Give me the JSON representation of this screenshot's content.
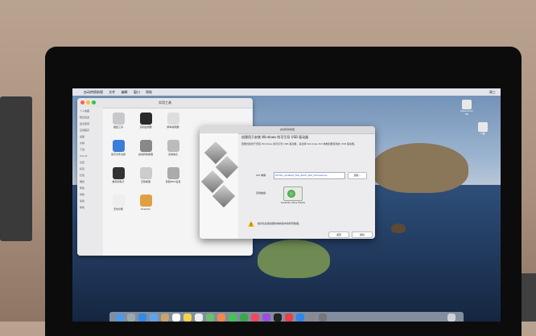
{
  "menubar": {
    "app": "启动转换助理",
    "items": [
      "文件",
      "编辑",
      "窗口",
      "帮助"
    ],
    "right": "周三"
  },
  "finder": {
    "title": "实用工具",
    "sidebar": [
      "个人收藏",
      "隔空投送",
      "最近使用",
      "应用程序",
      "桌面",
      "文稿",
      "下载",
      "iCloud",
      "位置",
      "标签",
      "红色",
      "橙色",
      "黄色",
      "绿色",
      "蓝色",
      "紫色"
    ],
    "apps": [
      {
        "label": "磁盘工具",
        "color": "#c8c8cc"
      },
      {
        "label": "活动监视器",
        "color": "#2a2a2a"
      },
      {
        "label": "脚本编辑器",
        "color": "#ddd"
      },
      {
        "label": "蓝牙文件交换",
        "color": "#3b7dd8"
      },
      {
        "label": "启动转换助理",
        "color": "#888"
      },
      {
        "label": "系统信息",
        "color": "#bbb"
      },
      {
        "label": "数码测色计",
        "color": "#333"
      },
      {
        "label": "迁移助理",
        "color": "#ccc"
      },
      {
        "label": "音频MIDI设置",
        "color": "#aaa"
      },
      {
        "label": "无线诊断",
        "color": "#eee"
      },
      {
        "label": "Grapher",
        "color": "#e0a040"
      }
    ]
  },
  "dialog": {
    "bar_title": "启动转换助理",
    "title": "创建用于安装 Windows 的可引导 USB 驱动器",
    "description": "若要创建用于安装 Windows 的可引导 USB 驱动器，请选择 Windows ISO 映像和要使用的 USB 驱动器。",
    "iso_label": "ISO 映像:",
    "iso_value": "Win10_updated_feb_2024_x64_Chinese.iso",
    "choose_label": "选取…",
    "destination_label": "目的磁盘:",
    "disk_name": "SanDisk Ultra Media",
    "warning": "格式化此驱动器将抹掉其中的所有数据。",
    "back_label": "返回",
    "continue_label": "继续"
  },
  "desktop": {
    "icons": [
      "Macintosh HD",
      "U盘"
    ]
  },
  "colors": {
    "sky": "#8fa8c6",
    "sea": "#1f3658",
    "accent": "#2255bb"
  }
}
